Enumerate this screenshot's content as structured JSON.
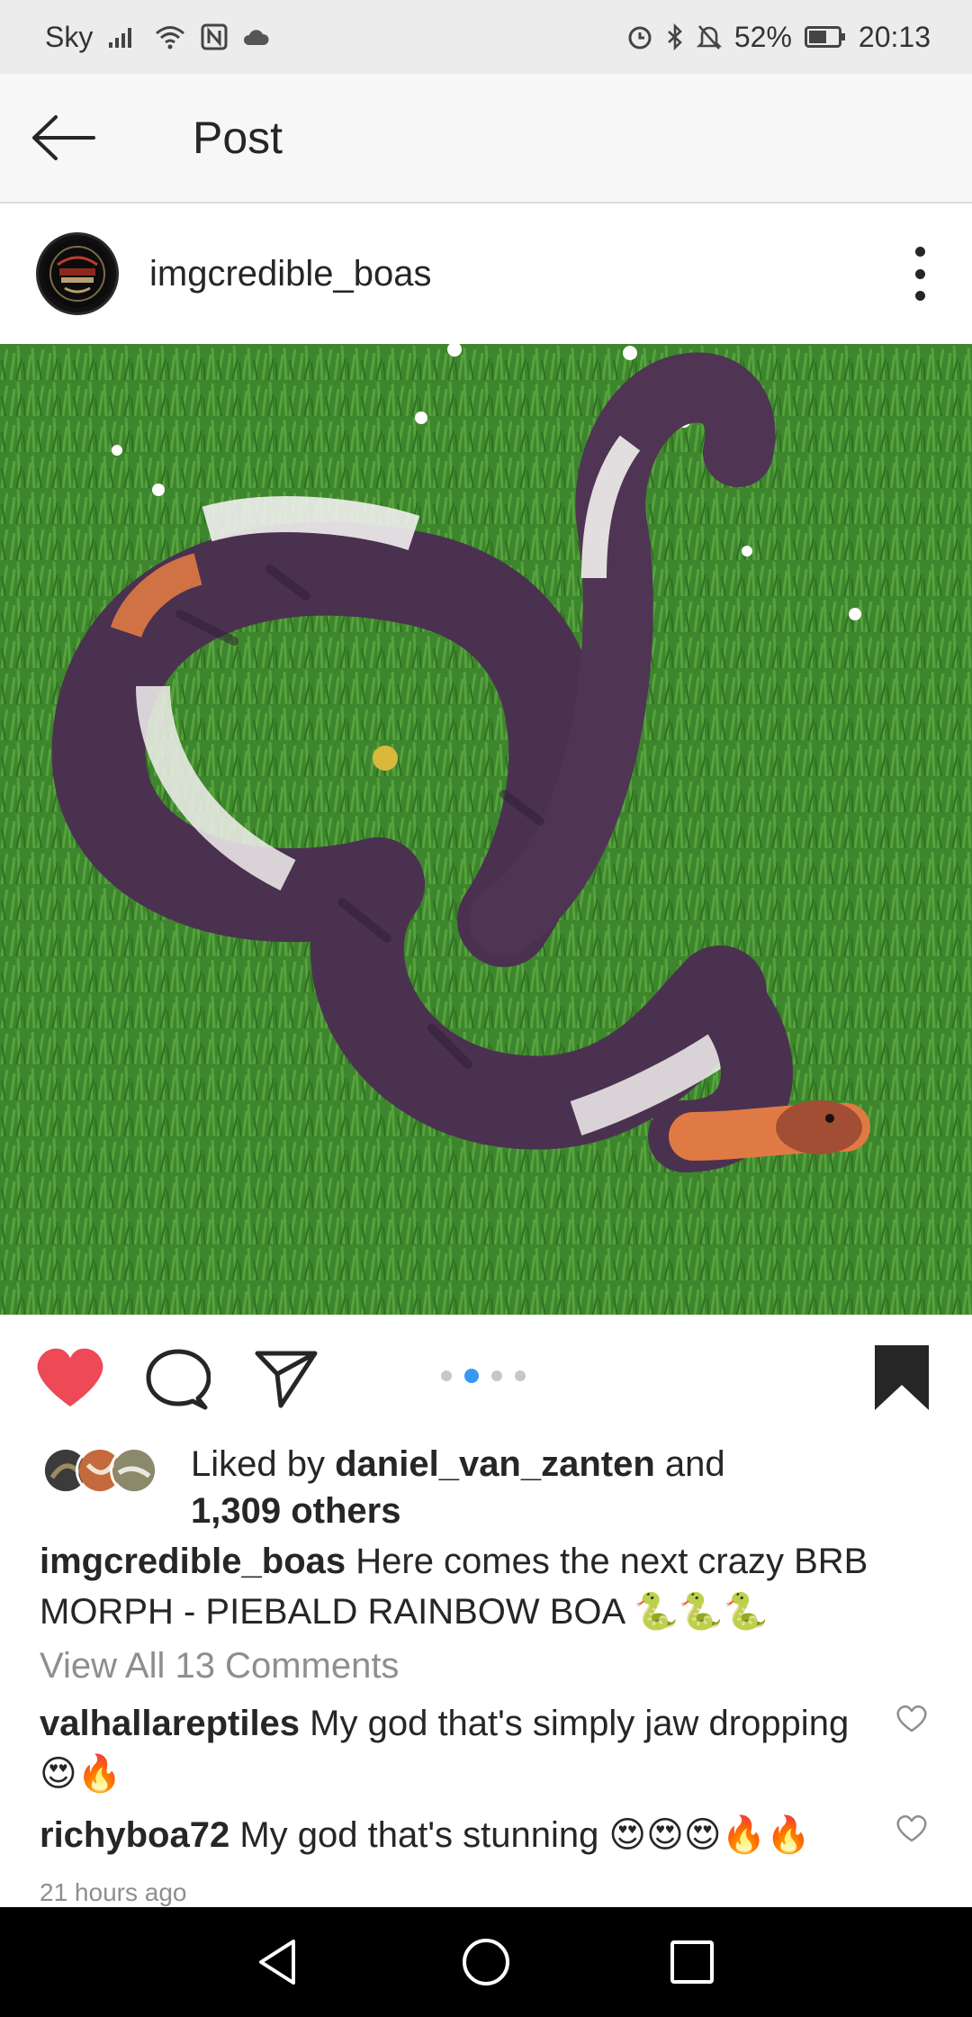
{
  "status_bar": {
    "carrier": "Sky",
    "battery": "52%",
    "time": "20:13"
  },
  "header": {
    "title": "Post"
  },
  "post": {
    "username": "imgcredible_boas",
    "carousel": {
      "count": 4,
      "active_index": 1
    },
    "likes": {
      "prefix": "Liked by ",
      "user": "daniel_van_zanten",
      "middle": " and",
      "others": "1,309 others"
    },
    "caption": {
      "username": "imgcredible_boas",
      "text": " Here comes the next crazy BRB MORPH - PIEBALD RAINBOW BOA 🐍🐍🐍"
    },
    "view_all_comments": "View All 13 Comments",
    "comments": [
      {
        "username": "valhallareptiles",
        "text": " My god that's simply jaw dropping😍🔥"
      },
      {
        "username": "richyboa72",
        "text": " My god that's stunning 😍😍😍🔥🔥"
      }
    ],
    "timestamp": "21 hours ago"
  },
  "colors": {
    "like_active": "#ed4956",
    "carousel_active": "#3897f0"
  },
  "icons": [
    "back-arrow-icon",
    "more-options-icon",
    "heart-icon",
    "comment-icon",
    "share-icon",
    "bookmark-icon",
    "back-nav-icon",
    "home-nav-icon",
    "recents-nav-icon"
  ]
}
